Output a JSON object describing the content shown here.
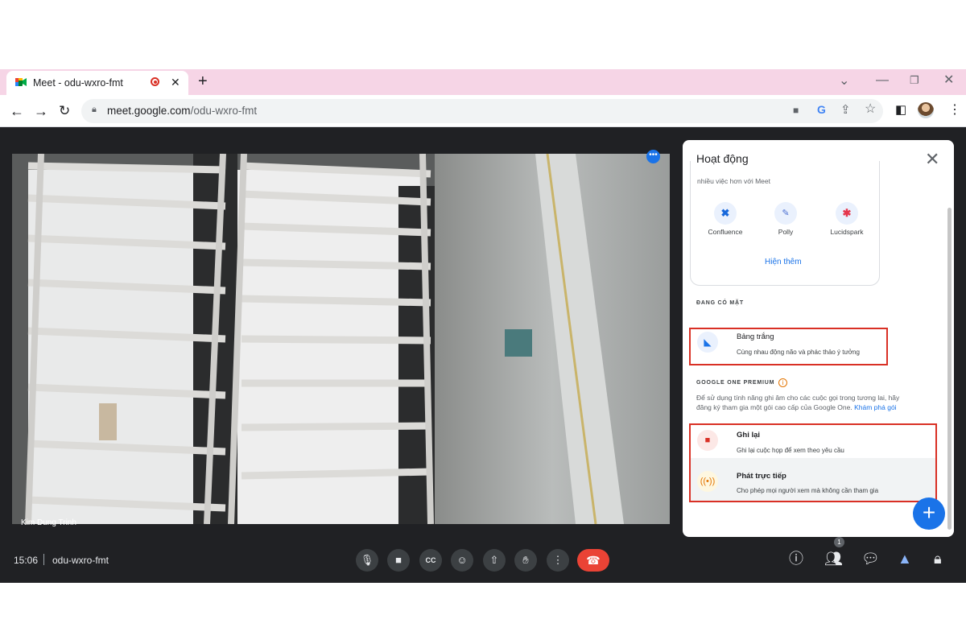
{
  "browser": {
    "tab_title": "Meet - odu-wxro-fmt",
    "url_domain": "meet.google.com",
    "url_path": "/odu-wxro-fmt",
    "new_tab_label": "+"
  },
  "meeting": {
    "participant_name": "Kim Dung Trinh",
    "time": "15:06",
    "code": "odu-wxro-fmt",
    "people_count": "1"
  },
  "panel": {
    "title": "Hoạt động",
    "addons_text": "nhiều việc hơn với Meet",
    "apps": [
      {
        "label": "Confluence",
        "icon": "confluence-icon"
      },
      {
        "label": "Polly",
        "icon": "polly-icon"
      },
      {
        "label": "Lucidspark",
        "icon": "lucidspark-icon"
      }
    ],
    "show_more": "Hiện thêm",
    "available_heading": "ĐANG CÓ MẶT",
    "whiteboard_title": "Bảng trắng",
    "whiteboard_sub": "Cùng nhau động não và phác thảo ý tưởng",
    "premium_heading": "GOOGLE ONE PREMIUM",
    "premium_text": "Để sử dụng tính năng ghi âm cho các cuộc gọi trong tương lai, hãy đăng ký tham gia một gói cao cấp của Google One.",
    "premium_link": "Khám phá gói",
    "record_title": "Ghi lại",
    "record_sub": "Ghi lại cuộc họp để xem theo yêu cầu",
    "live_title": "Phát trực tiếp",
    "live_sub": "Cho phép mọi người xem mà không cần tham gia"
  },
  "colors": {
    "accent": "#1a73e8",
    "hangup": "#ea4335",
    "highlight_box": "#d93025",
    "tab_strip": "#f6d5e6"
  }
}
